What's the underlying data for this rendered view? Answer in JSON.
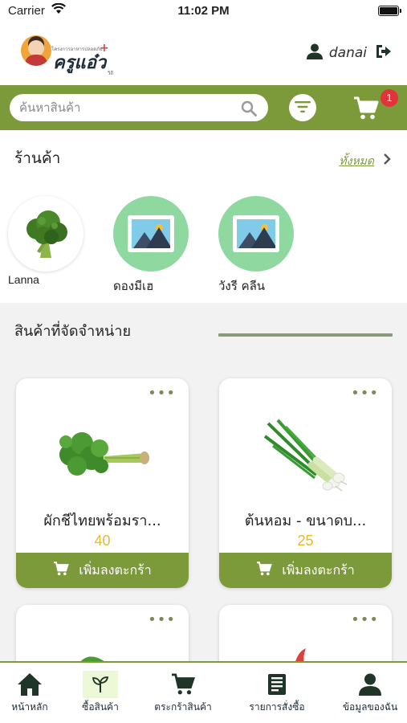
{
  "status_bar": {
    "carrier": "Carrier",
    "time": "11:02 PM"
  },
  "header": {
    "logo_tagline": "โครงการอาหารปลอดภัย",
    "logo_brand": "ครูแอ๋ว",
    "logo_sub": "วิถี",
    "username": "danai"
  },
  "search": {
    "placeholder": "ค้นหาสินค้า",
    "cart_count": "1"
  },
  "shops": {
    "title": "ร้านค้า",
    "view_all": "ทั้งหมด",
    "items": [
      {
        "name": "Lanna"
      },
      {
        "name": "ดองมีเฮ"
      },
      {
        "name": "วังรี คลีน"
      }
    ]
  },
  "products": {
    "title": "สินค้าที่จัดจำหน่าย",
    "add_to_cart_label": "เพิ่มลงตะกร้า",
    "items": [
      {
        "name": "ผักชีไทยพร้อมรา...",
        "price": "40"
      },
      {
        "name": "ต้นหอม - ขนาดบ...",
        "price": "25"
      }
    ]
  },
  "tabbar": {
    "items": [
      {
        "label": "หน้าหลัก"
      },
      {
        "label": "ซื้อสินค้า"
      },
      {
        "label": "ตระกร้าสินค้า"
      },
      {
        "label": "รายการสั่งซื้อ"
      },
      {
        "label": "ข้อมูลของฉัน"
      }
    ]
  },
  "colors": {
    "accent": "#7c9a3a",
    "price": "#e8b830",
    "badge": "#e2323a"
  }
}
